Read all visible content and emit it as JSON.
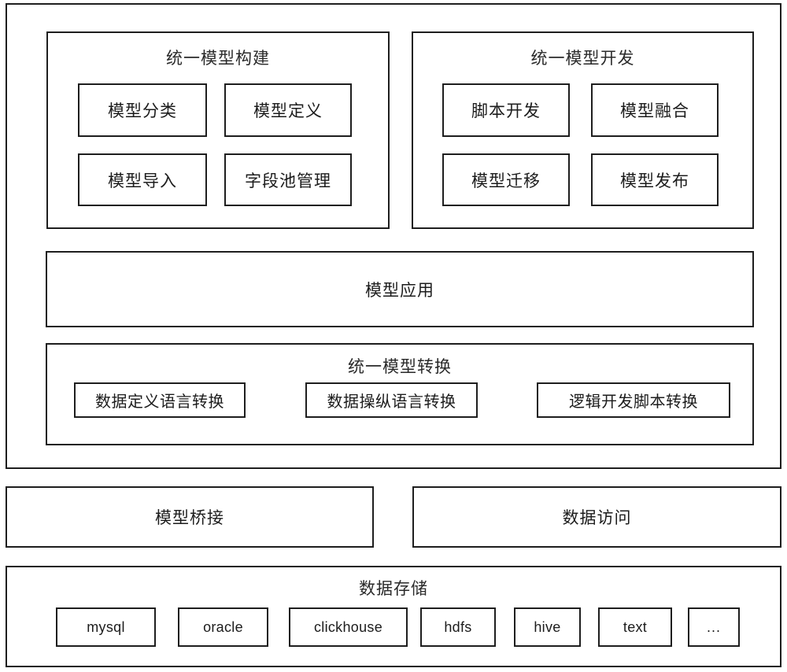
{
  "diagram": {
    "title_shown": false,
    "stroke_color": "#1e1e1e",
    "background_color": "#ffffff",
    "text_color": "#2a2a2a"
  },
  "platform_layer": {
    "build_panel": {
      "title": "统一模型构建",
      "items": [
        {
          "label": "模型分类"
        },
        {
          "label": "模型定义"
        },
        {
          "label": "模型导入"
        },
        {
          "label": "字段池管理"
        }
      ]
    },
    "develop_panel": {
      "title": "统一模型开发",
      "items": [
        {
          "label": "脚本开发"
        },
        {
          "label": "模型融合"
        },
        {
          "label": "模型迁移"
        },
        {
          "label": "模型发布"
        }
      ]
    },
    "application_band": {
      "title": "模型应用"
    },
    "conversion_band": {
      "title": "统一模型转换",
      "items": [
        {
          "label": "数据定义语言转换"
        },
        {
          "label": "数据操纵语言转换"
        },
        {
          "label": "逻辑开发脚本转换"
        }
      ]
    }
  },
  "middleware_layer": {
    "bridge": {
      "label": "模型桥接"
    },
    "access": {
      "label": "数据访问"
    }
  },
  "storage_layer": {
    "title": "数据存储",
    "items": [
      {
        "label": "mysql"
      },
      {
        "label": "oracle"
      },
      {
        "label": "clickhouse"
      },
      {
        "label": "hdfs"
      },
      {
        "label": "hive"
      },
      {
        "label": "text"
      },
      {
        "label": "..."
      }
    ]
  }
}
